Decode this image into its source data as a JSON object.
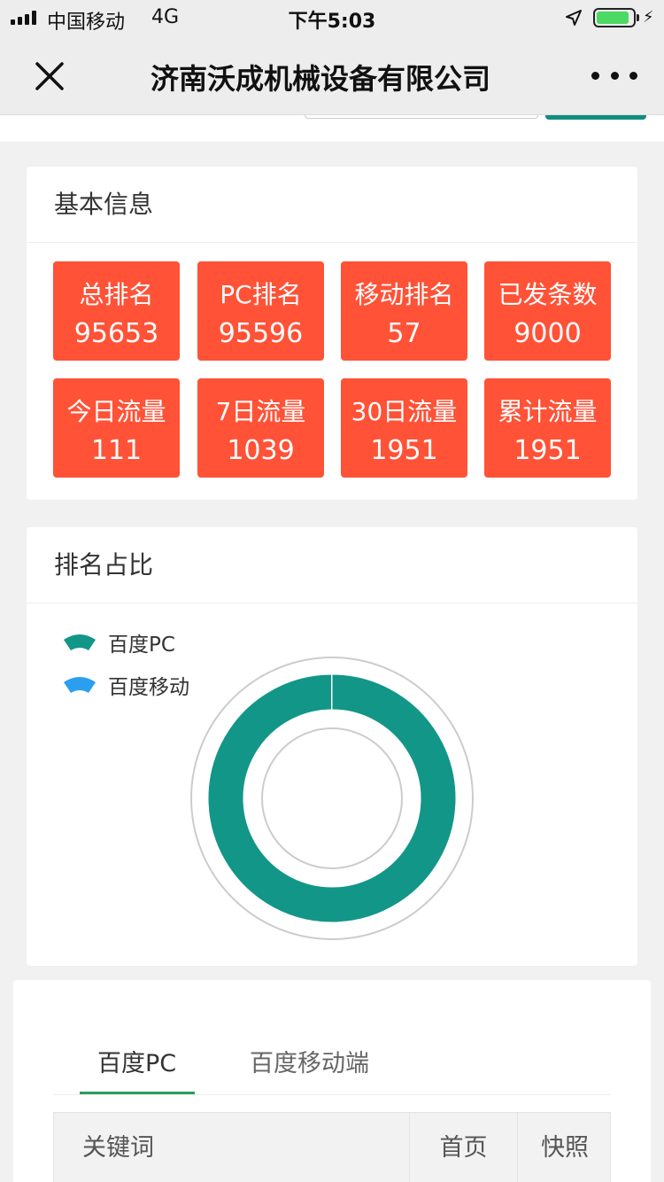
{
  "status_bar": {
    "carrier": "中国移动",
    "network": "4G",
    "time": "下午5:03",
    "battery_level": 0.9,
    "battery_color": "#4cd964"
  },
  "nav": {
    "title": "济南沃成机械设备有限公司",
    "close_icon": "close-icon",
    "more_icon": "more-icon"
  },
  "basic_info": {
    "title": "基本信息",
    "stat_color": "#ff5237",
    "stats": [
      {
        "label": "总排名",
        "value": "95653"
      },
      {
        "label": "PC排名",
        "value": "95596"
      },
      {
        "label": "移动排名",
        "value": "57"
      },
      {
        "label": "已发条数",
        "value": "9000"
      },
      {
        "label": "今日流量",
        "value": "111"
      },
      {
        "label": "7日流量",
        "value": "1039"
      },
      {
        "label": "30日流量",
        "value": "1951"
      },
      {
        "label": "累计流量",
        "value": "1951"
      }
    ]
  },
  "rank_share": {
    "title": "排名占比",
    "legend": [
      {
        "label": "百度PC",
        "color": "#129688"
      },
      {
        "label": "百度移动",
        "color": "#2a9ff0"
      }
    ],
    "chart_data": {
      "type": "pie",
      "categories": [
        "百度PC",
        "百度移动"
      ],
      "values": [
        95596,
        57
      ],
      "colors": [
        "#129688",
        "#2a9ff0"
      ]
    }
  },
  "rank_table": {
    "tabs": [
      {
        "label": "百度PC",
        "active": true
      },
      {
        "label": "百度移动端",
        "active": false
      }
    ],
    "active_color": "#2a9d5b",
    "columns": [
      "关键词",
      "首页",
      "快照"
    ]
  }
}
